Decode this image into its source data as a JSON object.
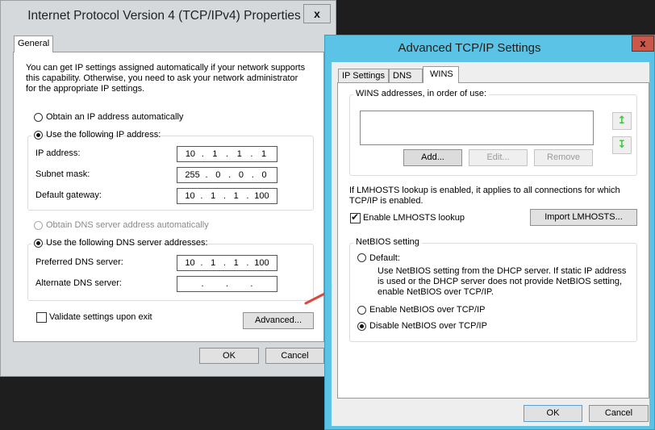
{
  "ipv4_dialog": {
    "title": "Internet Protocol Version 4 (TCP/IPv4) Properties",
    "close_label": "x",
    "tabs": [
      {
        "label": "General",
        "active": true
      }
    ],
    "intro_text": [
      "You can get IP settings assigned automatically if your network supports",
      "this capability. Otherwise, you need to ask your network administrator",
      "for the appropriate IP settings."
    ],
    "ip_mode": {
      "auto_label": "Obtain an IP address automatically",
      "manual_label": "Use the following IP address:",
      "selected": "manual"
    },
    "ip_fields": [
      {
        "label": "IP address:",
        "octets": [
          "10",
          "1",
          "1",
          "1"
        ]
      },
      {
        "label": "Subnet mask:",
        "octets": [
          "255",
          "0",
          "0",
          "0"
        ]
      },
      {
        "label": "Default gateway:",
        "octets": [
          "10",
          "1",
          "1",
          "100"
        ]
      }
    ],
    "dns_mode": {
      "auto_label": "Obtain DNS server address automatically",
      "auto_disabled": true,
      "manual_label": "Use the following DNS server addresses:",
      "selected": "manual"
    },
    "dns_fields": [
      {
        "label": "Preferred DNS server:",
        "octets": [
          "10",
          "1",
          "1",
          "100"
        ]
      },
      {
        "label": "Alternate DNS server:",
        "octets": [
          "",
          "",
          "",
          ""
        ]
      }
    ],
    "validate_label": "Validate settings upon exit",
    "validate_checked": false,
    "advanced_label": "Advanced...",
    "ok_label": "OK",
    "cancel_label": "Cancel"
  },
  "advanced_dialog": {
    "title": "Advanced TCP/IP Settings",
    "close_label": "x",
    "tabs": [
      {
        "label": "IP Settings",
        "active": false
      },
      {
        "label": "DNS",
        "active": false
      },
      {
        "label": "WINS",
        "active": true
      }
    ],
    "wins_group_label": "WINS addresses, in order of use:",
    "wins_addresses": [],
    "move_up_icon": "↥",
    "move_down_icon": "↧",
    "add_label": "Add...",
    "edit_label": "Edit...",
    "remove_label": "Remove",
    "lmhosts_text": [
      "If LMHOSTS lookup is enabled, it applies to all connections for which",
      "TCP/IP is enabled."
    ],
    "enable_lmhosts_label": "Enable LMHOSTS lookup",
    "enable_lmhosts_checked": true,
    "import_lmhosts_label": "Import LMHOSTS...",
    "netbios_group_label": "NetBIOS setting",
    "netbios_options": [
      {
        "label": "Default:",
        "selected": false
      },
      {
        "label": "Enable NetBIOS over TCP/IP",
        "selected": false
      },
      {
        "label": "Disable NetBIOS over TCP/IP",
        "selected": true
      }
    ],
    "netbios_default_desc": [
      "Use NetBIOS setting from the DHCP server. If static IP address",
      "is used or the DHCP server does not provide NetBIOS setting,",
      "enable NetBIOS over TCP/IP."
    ],
    "ok_label": "OK",
    "cancel_label": "Cancel"
  },
  "colors": {
    "active_titlebar": "#5bc4e6",
    "close_button": "#c9584b",
    "annotation_arrow": "#e0453a",
    "arrow_button_glyph": "#45c043"
  }
}
